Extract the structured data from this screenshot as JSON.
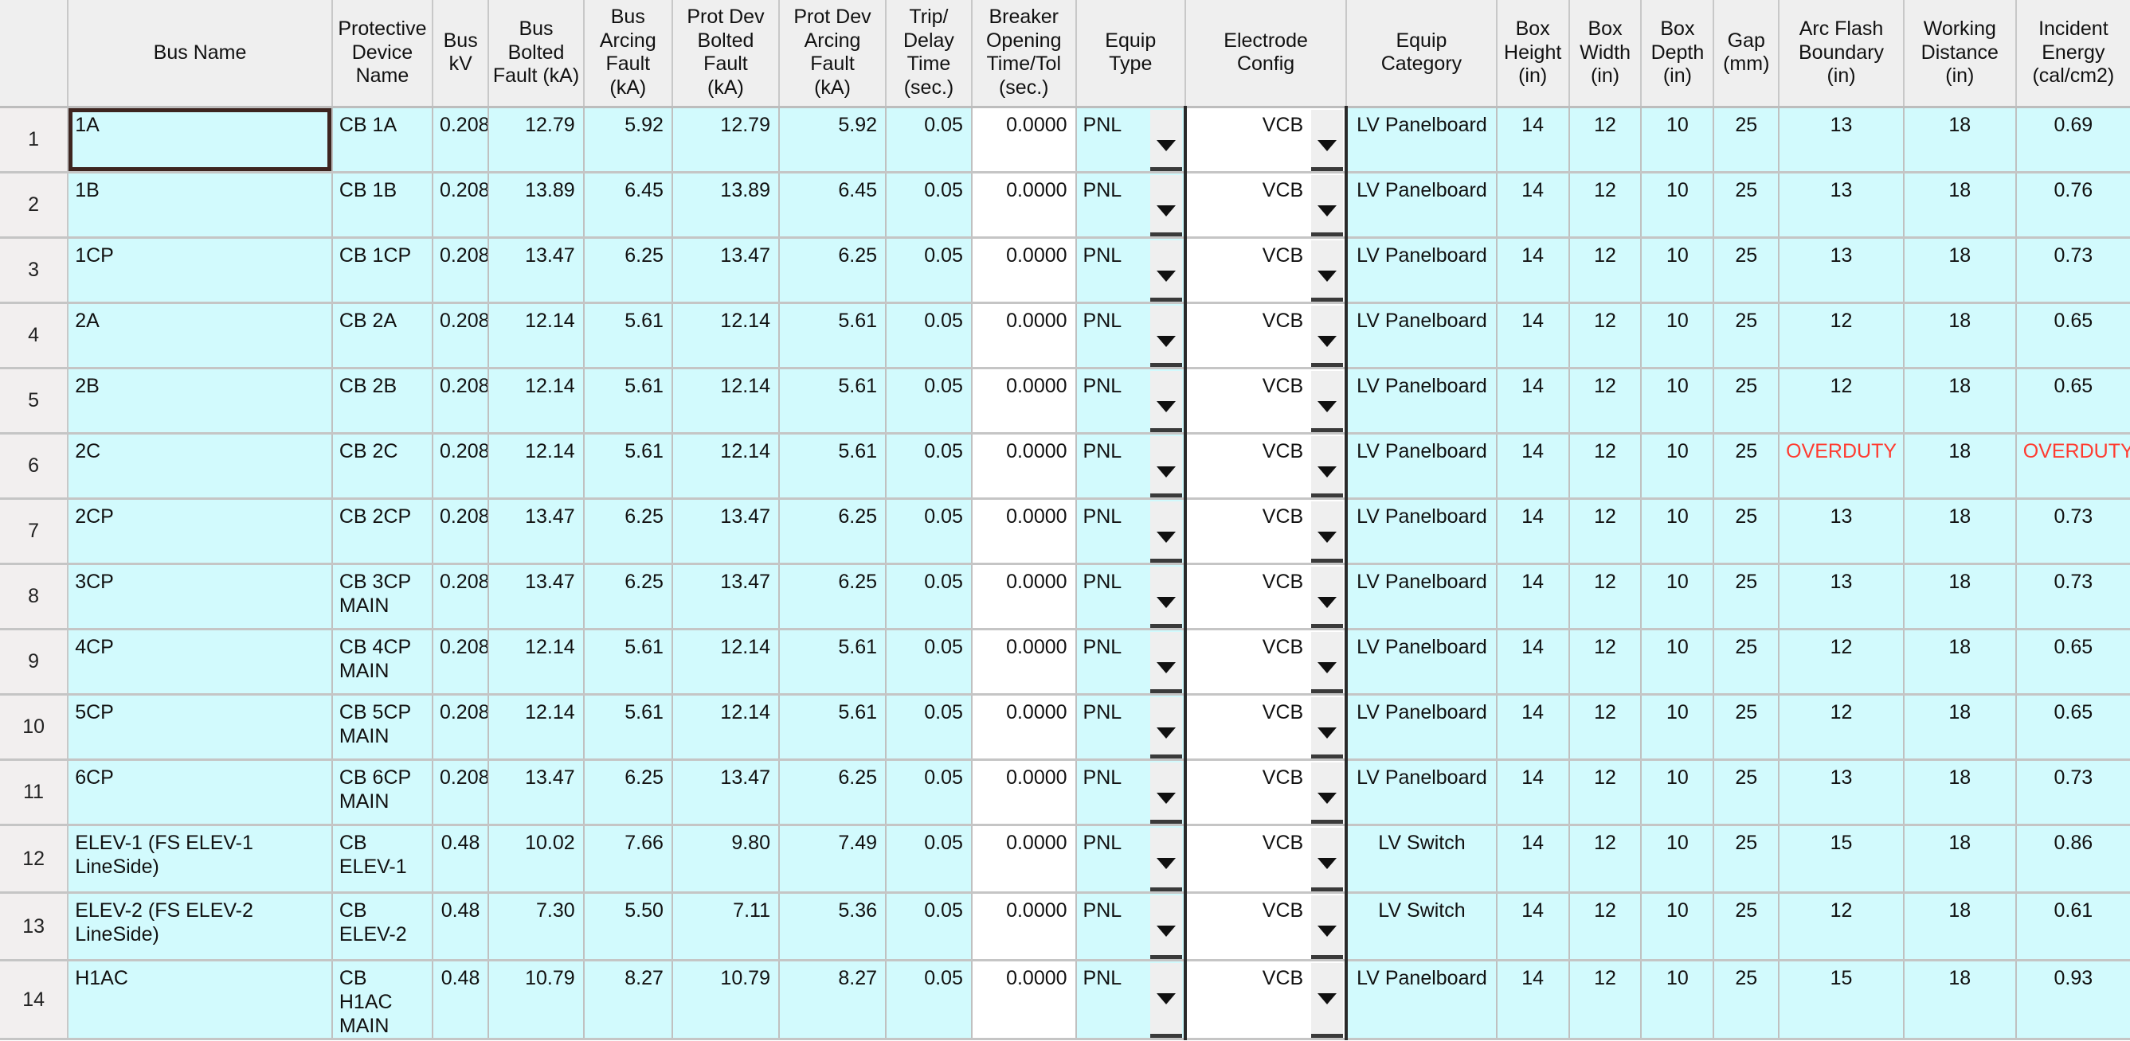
{
  "table": {
    "row_number_header": "",
    "columns": [
      {
        "key": "bus_name",
        "label": "Bus Name",
        "align": "left"
      },
      {
        "key": "prot_dev_name",
        "label": "Protective\nDevice Name",
        "align": "left"
      },
      {
        "key": "bus_kv",
        "label": "Bus\nkV",
        "align": "right"
      },
      {
        "key": "bus_bolted_fault",
        "label": "Bus\nBolted\nFault (kA)",
        "align": "right"
      },
      {
        "key": "bus_arcing_fault",
        "label": "Bus\nArcing\nFault (kA)",
        "align": "right"
      },
      {
        "key": "prot_dev_bolted_fault",
        "label": "Prot Dev\nBolted\nFault\n(kA)",
        "align": "right"
      },
      {
        "key": "prot_dev_arcing_fault",
        "label": "Prot Dev\nArcing\nFault\n(kA)",
        "align": "right"
      },
      {
        "key": "trip_delay_time",
        "label": "Trip/\nDelay\nTime\n(sec.)",
        "align": "right"
      },
      {
        "key": "breaker_opening_time",
        "label": "Breaker\nOpening\nTime/Tol\n(sec.)",
        "align": "right"
      },
      {
        "key": "equip_type",
        "label": "Equip\nType",
        "align": "left"
      },
      {
        "key": "electrode_config",
        "label": "Electrode\nConfig",
        "align": "right"
      },
      {
        "key": "equip_category",
        "label": "Equip\nCategory",
        "align": "center"
      },
      {
        "key": "box_height",
        "label": "Box\nHeight\n(in)",
        "align": "center"
      },
      {
        "key": "box_width",
        "label": "Box\nWidth\n(in)",
        "align": "center"
      },
      {
        "key": "box_depth",
        "label": "Box\nDepth\n(in)",
        "align": "center"
      },
      {
        "key": "gap",
        "label": "Gap\n(mm)",
        "align": "center"
      },
      {
        "key": "arc_flash_boundary",
        "label": "Arc Flash\nBoundary\n(in)",
        "align": "center"
      },
      {
        "key": "working_distance",
        "label": "Working\nDistance\n(in)",
        "align": "center"
      },
      {
        "key": "incident_energy",
        "label": "Incident\nEnergy\n(cal/cm2)",
        "align": "center"
      }
    ],
    "dropdown_icon": "chevron-down-icon",
    "selected_cell": {
      "row": 1,
      "column": "bus_name"
    },
    "overduty_text": "OVERDUTY",
    "overduty_color": "#ff3b30",
    "cell_fill_color": "#d2fafd",
    "header_fill_color": "#efefef",
    "rows": [
      {
        "n": "1",
        "bus_name": "1A",
        "prot_dev_name": "CB 1A",
        "bus_kv": "0.208",
        "bus_bolted_fault": "12.79",
        "bus_arcing_fault": "5.92",
        "prot_dev_bolted_fault": "12.79",
        "prot_dev_arcing_fault": "5.92",
        "trip_delay_time": "0.05",
        "breaker_opening_time": "0.0000",
        "equip_type": "PNL",
        "electrode_config": "VCB",
        "equip_category": "LV Panelboard",
        "box_height": "14",
        "box_width": "12",
        "box_depth": "10",
        "gap": "25",
        "arc_flash_boundary": "13",
        "working_distance": "18",
        "incident_energy": "0.69",
        "height": "tall"
      },
      {
        "n": "2",
        "bus_name": "1B",
        "prot_dev_name": "CB 1B",
        "bus_kv": "0.208",
        "bus_bolted_fault": "13.89",
        "bus_arcing_fault": "6.45",
        "prot_dev_bolted_fault": "13.89",
        "prot_dev_arcing_fault": "6.45",
        "trip_delay_time": "0.05",
        "breaker_opening_time": "0.0000",
        "equip_type": "PNL",
        "electrode_config": "VCB",
        "equip_category": "LV Panelboard",
        "box_height": "14",
        "box_width": "12",
        "box_depth": "10",
        "gap": "25",
        "arc_flash_boundary": "13",
        "working_distance": "18",
        "incident_energy": "0.76",
        "height": "tall"
      },
      {
        "n": "3",
        "bus_name": "1CP",
        "prot_dev_name": "CB 1CP",
        "bus_kv": "0.208",
        "bus_bolted_fault": "13.47",
        "bus_arcing_fault": "6.25",
        "prot_dev_bolted_fault": "13.47",
        "prot_dev_arcing_fault": "6.25",
        "trip_delay_time": "0.05",
        "breaker_opening_time": "0.0000",
        "equip_type": "PNL",
        "electrode_config": "VCB",
        "equip_category": "LV Panelboard",
        "box_height": "14",
        "box_width": "12",
        "box_depth": "10",
        "gap": "25",
        "arc_flash_boundary": "13",
        "working_distance": "18",
        "incident_energy": "0.73",
        "height": "tall"
      },
      {
        "n": "4",
        "bus_name": "2A",
        "prot_dev_name": "CB 2A",
        "bus_kv": "0.208",
        "bus_bolted_fault": "12.14",
        "bus_arcing_fault": "5.61",
        "prot_dev_bolted_fault": "12.14",
        "prot_dev_arcing_fault": "5.61",
        "trip_delay_time": "0.05",
        "breaker_opening_time": "0.0000",
        "equip_type": "PNL",
        "electrode_config": "VCB",
        "equip_category": "LV Panelboard",
        "box_height": "14",
        "box_width": "12",
        "box_depth": "10",
        "gap": "25",
        "arc_flash_boundary": "12",
        "working_distance": "18",
        "incident_energy": "0.65",
        "height": "tall"
      },
      {
        "n": "5",
        "bus_name": "2B",
        "prot_dev_name": "CB 2B",
        "bus_kv": "0.208",
        "bus_bolted_fault": "12.14",
        "bus_arcing_fault": "5.61",
        "prot_dev_bolted_fault": "12.14",
        "prot_dev_arcing_fault": "5.61",
        "trip_delay_time": "0.05",
        "breaker_opening_time": "0.0000",
        "equip_type": "PNL",
        "electrode_config": "VCB",
        "equip_category": "LV Panelboard",
        "box_height": "14",
        "box_width": "12",
        "box_depth": "10",
        "gap": "25",
        "arc_flash_boundary": "12",
        "working_distance": "18",
        "incident_energy": "0.65",
        "height": "tall"
      },
      {
        "n": "6",
        "bus_name": "2C",
        "prot_dev_name": "CB 2C",
        "bus_kv": "0.208",
        "bus_bolted_fault": "12.14",
        "bus_arcing_fault": "5.61",
        "prot_dev_bolted_fault": "12.14",
        "prot_dev_arcing_fault": "5.61",
        "trip_delay_time": "0.05",
        "breaker_opening_time": "0.0000",
        "equip_type": "PNL",
        "electrode_config": "VCB",
        "equip_category": "LV Panelboard",
        "box_height": "14",
        "box_width": "12",
        "box_depth": "10",
        "gap": "25",
        "arc_flash_boundary": "OVERDUTY",
        "working_distance": "18",
        "incident_energy": "OVERDUTY",
        "height": "tall"
      },
      {
        "n": "7",
        "bus_name": "2CP",
        "prot_dev_name": "CB 2CP",
        "bus_kv": "0.208",
        "bus_bolted_fault": "13.47",
        "bus_arcing_fault": "6.25",
        "prot_dev_bolted_fault": "13.47",
        "prot_dev_arcing_fault": "6.25",
        "trip_delay_time": "0.05",
        "breaker_opening_time": "0.0000",
        "equip_type": "PNL",
        "electrode_config": "VCB",
        "equip_category": "LV Panelboard",
        "box_height": "14",
        "box_width": "12",
        "box_depth": "10",
        "gap": "25",
        "arc_flash_boundary": "13",
        "working_distance": "18",
        "incident_energy": "0.73",
        "height": "tall"
      },
      {
        "n": "8",
        "bus_name": "3CP",
        "prot_dev_name": "CB 3CP MAIN",
        "bus_kv": "0.208",
        "bus_bolted_fault": "13.47",
        "bus_arcing_fault": "6.25",
        "prot_dev_bolted_fault": "13.47",
        "prot_dev_arcing_fault": "6.25",
        "trip_delay_time": "0.05",
        "breaker_opening_time": "0.0000",
        "equip_type": "PNL",
        "electrode_config": "VCB",
        "equip_category": "LV Panelboard",
        "box_height": "14",
        "box_width": "12",
        "box_depth": "10",
        "gap": "25",
        "arc_flash_boundary": "13",
        "working_distance": "18",
        "incident_energy": "0.73",
        "height": "tall"
      },
      {
        "n": "9",
        "bus_name": "4CP",
        "prot_dev_name": "CB 4CP MAIN",
        "bus_kv": "0.208",
        "bus_bolted_fault": "12.14",
        "bus_arcing_fault": "5.61",
        "prot_dev_bolted_fault": "12.14",
        "prot_dev_arcing_fault": "5.61",
        "trip_delay_time": "0.05",
        "breaker_opening_time": "0.0000",
        "equip_type": "PNL",
        "electrode_config": "VCB",
        "equip_category": "LV Panelboard",
        "box_height": "14",
        "box_width": "12",
        "box_depth": "10",
        "gap": "25",
        "arc_flash_boundary": "12",
        "working_distance": "18",
        "incident_energy": "0.65",
        "height": "tall"
      },
      {
        "n": "10",
        "bus_name": "5CP",
        "prot_dev_name": "CB 5CP MAIN",
        "bus_kv": "0.208",
        "bus_bolted_fault": "12.14",
        "bus_arcing_fault": "5.61",
        "prot_dev_bolted_fault": "12.14",
        "prot_dev_arcing_fault": "5.61",
        "trip_delay_time": "0.05",
        "breaker_opening_time": "0.0000",
        "equip_type": "PNL",
        "electrode_config": "VCB",
        "equip_category": "LV Panelboard",
        "box_height": "14",
        "box_width": "12",
        "box_depth": "10",
        "gap": "25",
        "arc_flash_boundary": "12",
        "working_distance": "18",
        "incident_energy": "0.65",
        "height": "tall"
      },
      {
        "n": "11",
        "bus_name": "6CP",
        "prot_dev_name": "CB 6CP MAIN",
        "bus_kv": "0.208",
        "bus_bolted_fault": "13.47",
        "bus_arcing_fault": "6.25",
        "prot_dev_bolted_fault": "13.47",
        "prot_dev_arcing_fault": "6.25",
        "trip_delay_time": "0.05",
        "breaker_opening_time": "0.0000",
        "equip_type": "PNL",
        "electrode_config": "VCB",
        "equip_category": "LV Panelboard",
        "box_height": "14",
        "box_width": "12",
        "box_depth": "10",
        "gap": "25",
        "arc_flash_boundary": "13",
        "working_distance": "18",
        "incident_energy": "0.73",
        "height": "tall"
      },
      {
        "n": "12",
        "bus_name": "ELEV-1 (FS ELEV-1 LineSide)",
        "prot_dev_name": "CB ELEV-1",
        "bus_kv": "0.48",
        "bus_bolted_fault": "10.02",
        "bus_arcing_fault": "7.66",
        "prot_dev_bolted_fault": "9.80",
        "prot_dev_arcing_fault": "7.49",
        "trip_delay_time": "0.05",
        "breaker_opening_time": "0.0000",
        "equip_type": "PNL",
        "electrode_config": "VCB",
        "equip_category": "LV Switch",
        "box_height": "14",
        "box_width": "12",
        "box_depth": "10",
        "gap": "25",
        "arc_flash_boundary": "15",
        "working_distance": "18",
        "incident_energy": "0.86",
        "height": "short"
      },
      {
        "n": "13",
        "bus_name": "ELEV-2 (FS ELEV-2 LineSide)",
        "prot_dev_name": "CB ELEV-2",
        "bus_kv": "0.48",
        "bus_bolted_fault": "7.30",
        "bus_arcing_fault": "5.50",
        "prot_dev_bolted_fault": "7.11",
        "prot_dev_arcing_fault": "5.36",
        "trip_delay_time": "0.05",
        "breaker_opening_time": "0.0000",
        "equip_type": "PNL",
        "electrode_config": "VCB",
        "equip_category": "LV Switch",
        "box_height": "14",
        "box_width": "12",
        "box_depth": "10",
        "gap": "25",
        "arc_flash_boundary": "12",
        "working_distance": "18",
        "incident_energy": "0.61",
        "height": "short"
      },
      {
        "n": "14",
        "bus_name": "H1AC",
        "prot_dev_name": "CB H1AC MAIN",
        "bus_kv": "0.48",
        "bus_bolted_fault": "10.79",
        "bus_arcing_fault": "8.27",
        "prot_dev_bolted_fault": "10.79",
        "prot_dev_arcing_fault": "8.27",
        "trip_delay_time": "0.05",
        "breaker_opening_time": "0.0000",
        "equip_type": "PNL",
        "electrode_config": "VCB",
        "equip_category": "LV Panelboard",
        "box_height": "14",
        "box_width": "12",
        "box_depth": "10",
        "gap": "25",
        "arc_flash_boundary": "15",
        "working_distance": "18",
        "incident_energy": "0.93",
        "height": "short"
      }
    ]
  }
}
